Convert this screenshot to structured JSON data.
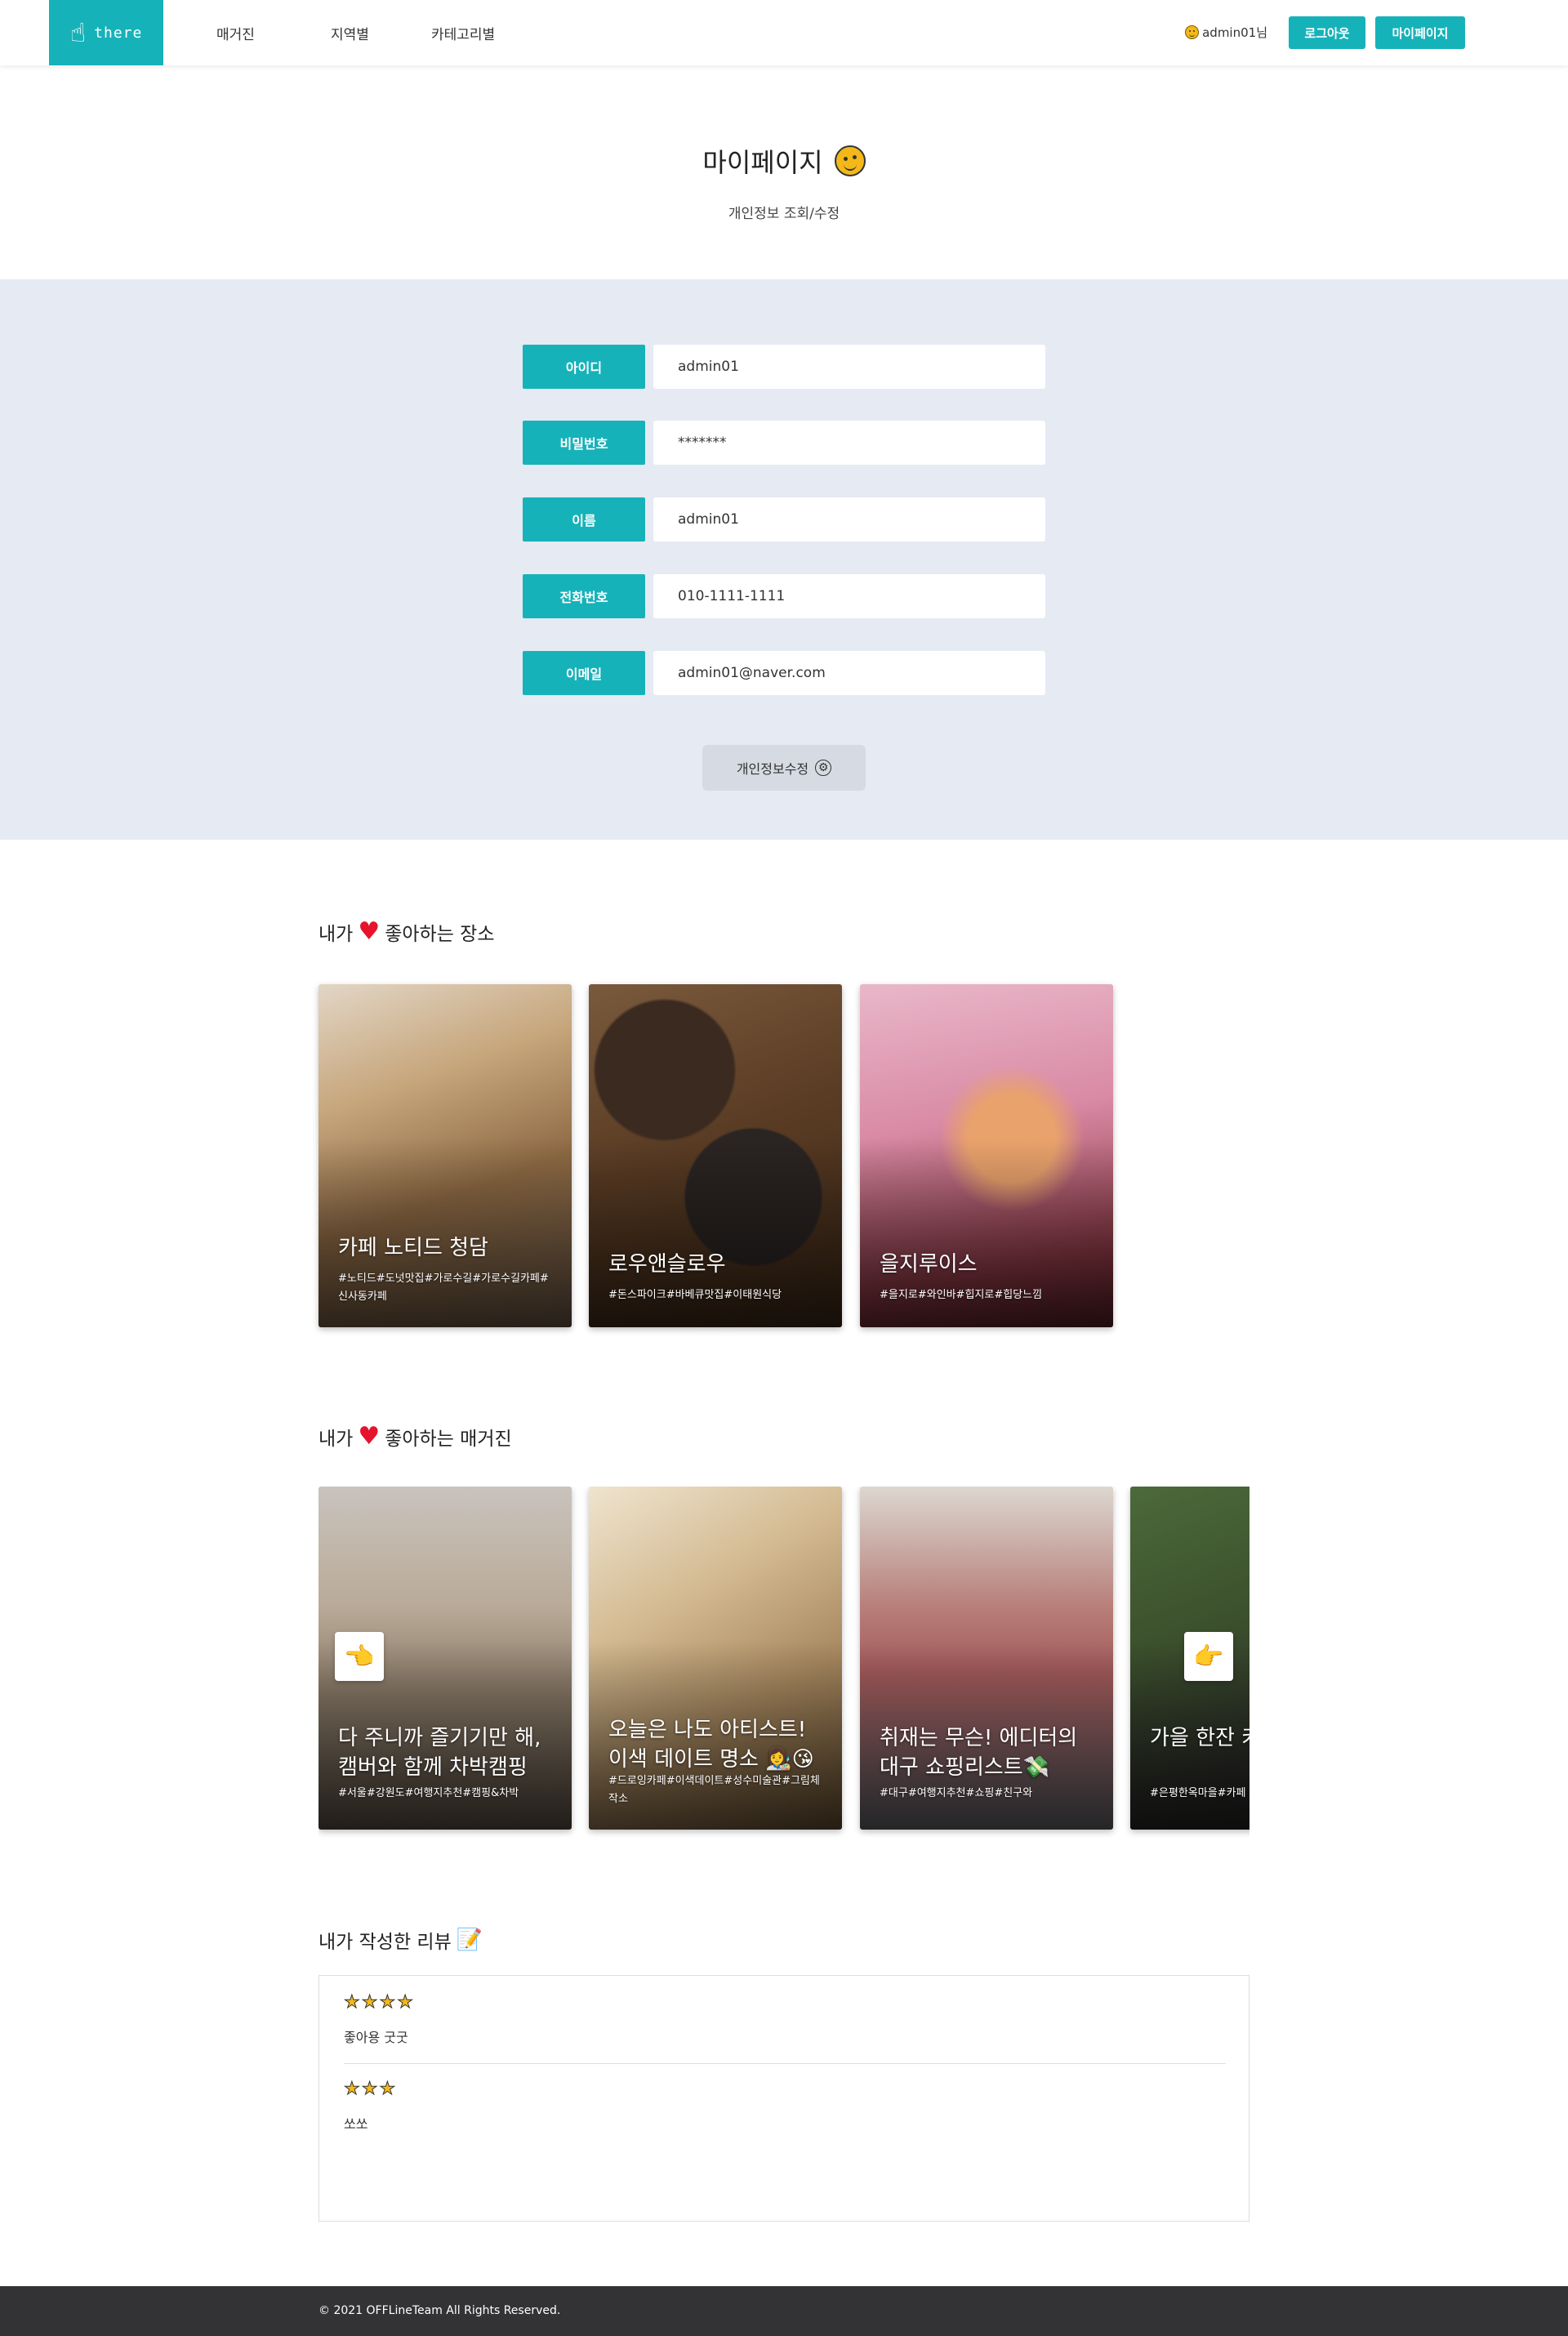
{
  "header": {
    "logo_text": "there",
    "nav": [
      "매거진",
      "지역별",
      "카테고리별"
    ],
    "user_greeting": "admin01님",
    "logout_label": "로그아웃",
    "mypage_label": "마이페이지"
  },
  "title": {
    "heading": "마이페이지",
    "subtitle": "개인정보 조회/수정"
  },
  "profile_form": {
    "fields": [
      {
        "label": "아이디",
        "value": "admin01"
      },
      {
        "label": "비밀번호",
        "value": "*******"
      },
      {
        "label": "이름",
        "value": "admin01"
      },
      {
        "label": "전화번호",
        "value": "010-1111-1111"
      },
      {
        "label": "이메일",
        "value": "admin01@naver.com"
      }
    ],
    "submit_label": "개인정보수정"
  },
  "liked_places": {
    "title_prefix": "내가",
    "title_suffix": "좋아하는 장소",
    "cards": [
      {
        "title": "카페 노티드 청담",
        "tags": "#노티드#도넛맛집#가로수길#가로수길카페#신사동카페"
      },
      {
        "title": "로우앤슬로우",
        "tags": "#돈스파이크#바베큐맛집#이태원식당"
      },
      {
        "title": "을지루이스",
        "tags": "#을지로#와인바#힙지로#힙당느낌"
      }
    ]
  },
  "liked_magazines": {
    "title_prefix": "내가",
    "title_suffix": "좋아하는 매거진",
    "cards": [
      {
        "title": "다 주니까 즐기기만 해, 캠버와 함께 차박캠핑",
        "tags": "#서울#강원도#여행지추천#캠핑&차박"
      },
      {
        "title": "오늘은 나도 아티스트! 이색 데이트 명소 👩‍🎨😘",
        "tags": "#드로잉카페#이색데이트#성수미술관#그림체작소"
      },
      {
        "title": "취재는 무슨! 에디터의 대구 쇼핑리스트💸",
        "tags": "#대구#여행지추천#쇼핑#친구와"
      },
      {
        "title": "가을 한잔 카페 은평 한옥마을",
        "tags": "#은평한옥마을#카페"
      }
    ]
  },
  "reviews": {
    "title": "내가 작성한 리뷰",
    "items": [
      {
        "rating": 4,
        "text": "좋아용 굿굿"
      },
      {
        "rating": 3,
        "text": "쏘쏘"
      }
    ]
  },
  "footer": {
    "copyright": "© 2021 OFFLineTeam All Rights Reserved."
  },
  "colors": {
    "accent": "#16b2b9",
    "band": "#e6eaf2",
    "footer": "#333336",
    "heart": "#e5142c",
    "star": "#f5b819"
  }
}
